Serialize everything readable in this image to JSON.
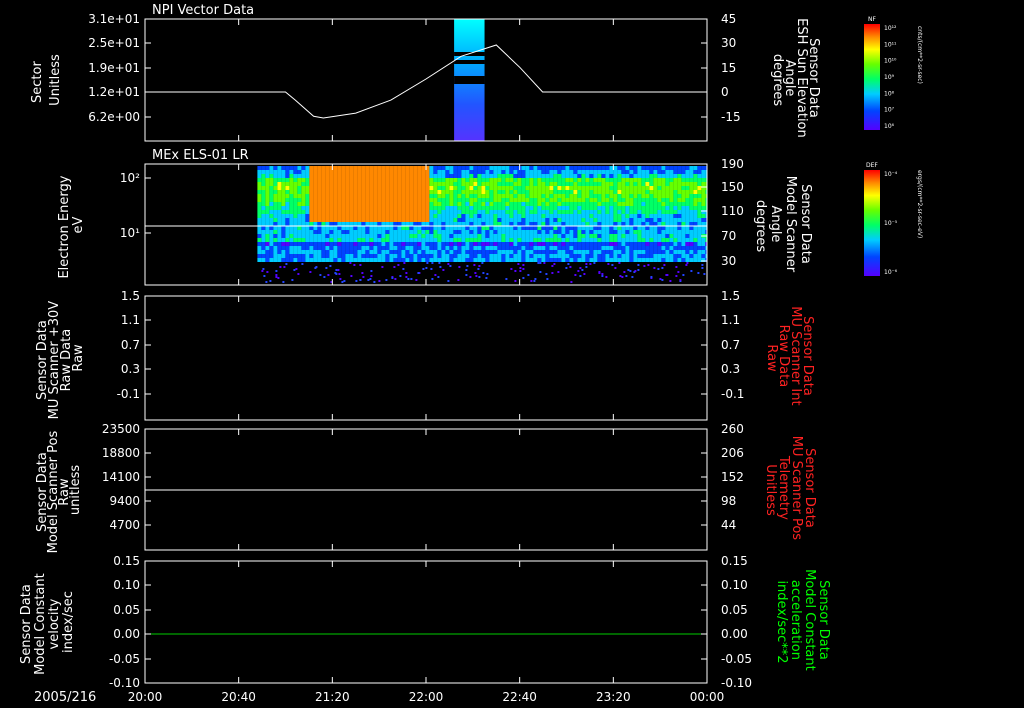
{
  "time_axis": {
    "date": "2005/216",
    "ticks": [
      "20:00",
      "20:40",
      "21:20",
      "22:00",
      "22:40",
      "23:20",
      "00:00"
    ]
  },
  "panels": [
    {
      "title": "NPI Vector Data",
      "left_label": [
        "Sector",
        "Unitless"
      ],
      "left_ticks": [
        "3.1e+01",
        "2.5e+01",
        "1.9e+01",
        "1.2e+01",
        "6.2e+00"
      ],
      "right_label": [
        "Sensor Data",
        "ESH Sun Elevation",
        "Angle",
        "degrees"
      ],
      "right_ticks": [
        "45",
        "30",
        "15",
        "0",
        "-15"
      ],
      "colorbar": {
        "tag": "NF",
        "unit": "cnts/(cm**2-sr-sec)",
        "ticks": [
          "10¹²",
          "10¹¹",
          "10¹⁰",
          "10⁹",
          "10⁸",
          "10⁷",
          "10⁶"
        ]
      }
    },
    {
      "title": "MEx ELS-01 LR",
      "left_label": [
        "Electron Energy",
        "eV"
      ],
      "left_ticks": [
        "10²",
        "10¹"
      ],
      "right_label": [
        "Sensor Data",
        "Model Scanner",
        "Angle",
        "degrees"
      ],
      "right_ticks": [
        "190",
        "150",
        "110",
        "70",
        "30"
      ],
      "colorbar": {
        "tag": "DEF",
        "unit": "ergs/(cm**2-sr-sec-eV)",
        "ticks": [
          "10⁻⁴",
          "10⁻⁵",
          "10⁻⁶"
        ]
      }
    },
    {
      "title": "",
      "left_label": [
        "Sensor Data",
        "MU Scanner +30V",
        "Raw Data",
        "Raw"
      ],
      "left_ticks": [
        "1.5",
        "1.1",
        "0.7",
        "0.3",
        "-0.1"
      ],
      "right_label": [
        "Sensor Data",
        "MU Scanner Int",
        "Raw Data",
        "Raw"
      ],
      "right_ticks": [
        "1.5",
        "1.1",
        "0.7",
        "0.3",
        "-0.1"
      ]
    },
    {
      "title": "",
      "left_label": [
        "Sensor Data",
        "Model Scanner Pos",
        "Raw",
        "unitless"
      ],
      "left_ticks": [
        "23500",
        "18800",
        "14100",
        "9400",
        "4700"
      ],
      "right_label": [
        "Sensor Data",
        "MU Scanner Pos",
        "Telemetry",
        "Unitless"
      ],
      "right_ticks": [
        "260",
        "206",
        "152",
        "98",
        "44"
      ]
    },
    {
      "title": "",
      "left_label": [
        "Sensor Data",
        "Model Constant",
        "velocity",
        "index/sec"
      ],
      "left_ticks": [
        "0.15",
        "0.10",
        "0.05",
        "0.00",
        "-0.05",
        "-0.10"
      ],
      "right_label": [
        "Sensor Data",
        "Model Constant",
        "acceleration",
        "index/sec**2"
      ],
      "right_ticks": [
        "0.15",
        "0.10",
        "0.05",
        "0.00",
        "-0.05",
        "-0.10"
      ]
    }
  ],
  "colors": {
    "axis": "#ffffff",
    "right_label_panel3": "#ff0000",
    "right_label_panel4": "#ff0000",
    "right_label_panel5": "#00ff00",
    "velocity_line": "#00cc00"
  },
  "chart_data": [
    {
      "type": "line",
      "panel": 1,
      "title": "NPI Vector Data",
      "series": [
        {
          "name": "",
          "x_hours": [
            20.0,
            20.67,
            21.0,
            21.07,
            21.2,
            21.27,
            21.5,
            21.75,
            22.0,
            22.25,
            22.5,
            22.67,
            22.83,
            24.0
          ],
          "y": [
            0,
            0,
            0,
            -5,
            -15,
            -16,
            -13,
            -5,
            8,
            22,
            29,
            15,
            0,
            0
          ]
        }
      ],
      "spectrogram_band": {
        "x_start": "22:12",
        "x_end": "22:25"
      },
      "xlim": [
        "20:00",
        "00:00"
      ],
      "ylim_right": [
        -25,
        45
      ],
      "ylabel": "Sector Unitless"
    },
    {
      "type": "heatmap",
      "panel": 2,
      "title": "MEx ELS-01 LR",
      "x_start": "20:48",
      "x_end": "00:00",
      "yscale": "log",
      "ylabel": "Electron Energy eV",
      "high_flux_segments": [
        [
          "21:10",
          "21:22"
        ],
        [
          "21:22",
          "22:00"
        ]
      ],
      "horizontal_reference_right": 87
    },
    {
      "type": "line",
      "panel": 3,
      "series": [],
      "ylim": [
        -0.3,
        1.5
      ]
    },
    {
      "type": "line",
      "panel": 4,
      "series": [
        {
          "name": "",
          "x": [
            "20:00",
            "00:00"
          ],
          "y": [
            11700,
            11700
          ]
        }
      ],
      "ylim": [
        0,
        23500
      ]
    },
    {
      "type": "line",
      "panel": 5,
      "series": [
        {
          "name": "",
          "x": [
            "20:00",
            "00:00"
          ],
          "y": [
            0.0,
            0.0
          ]
        }
      ],
      "ylim": [
        -0.1,
        0.15
      ]
    }
  ]
}
